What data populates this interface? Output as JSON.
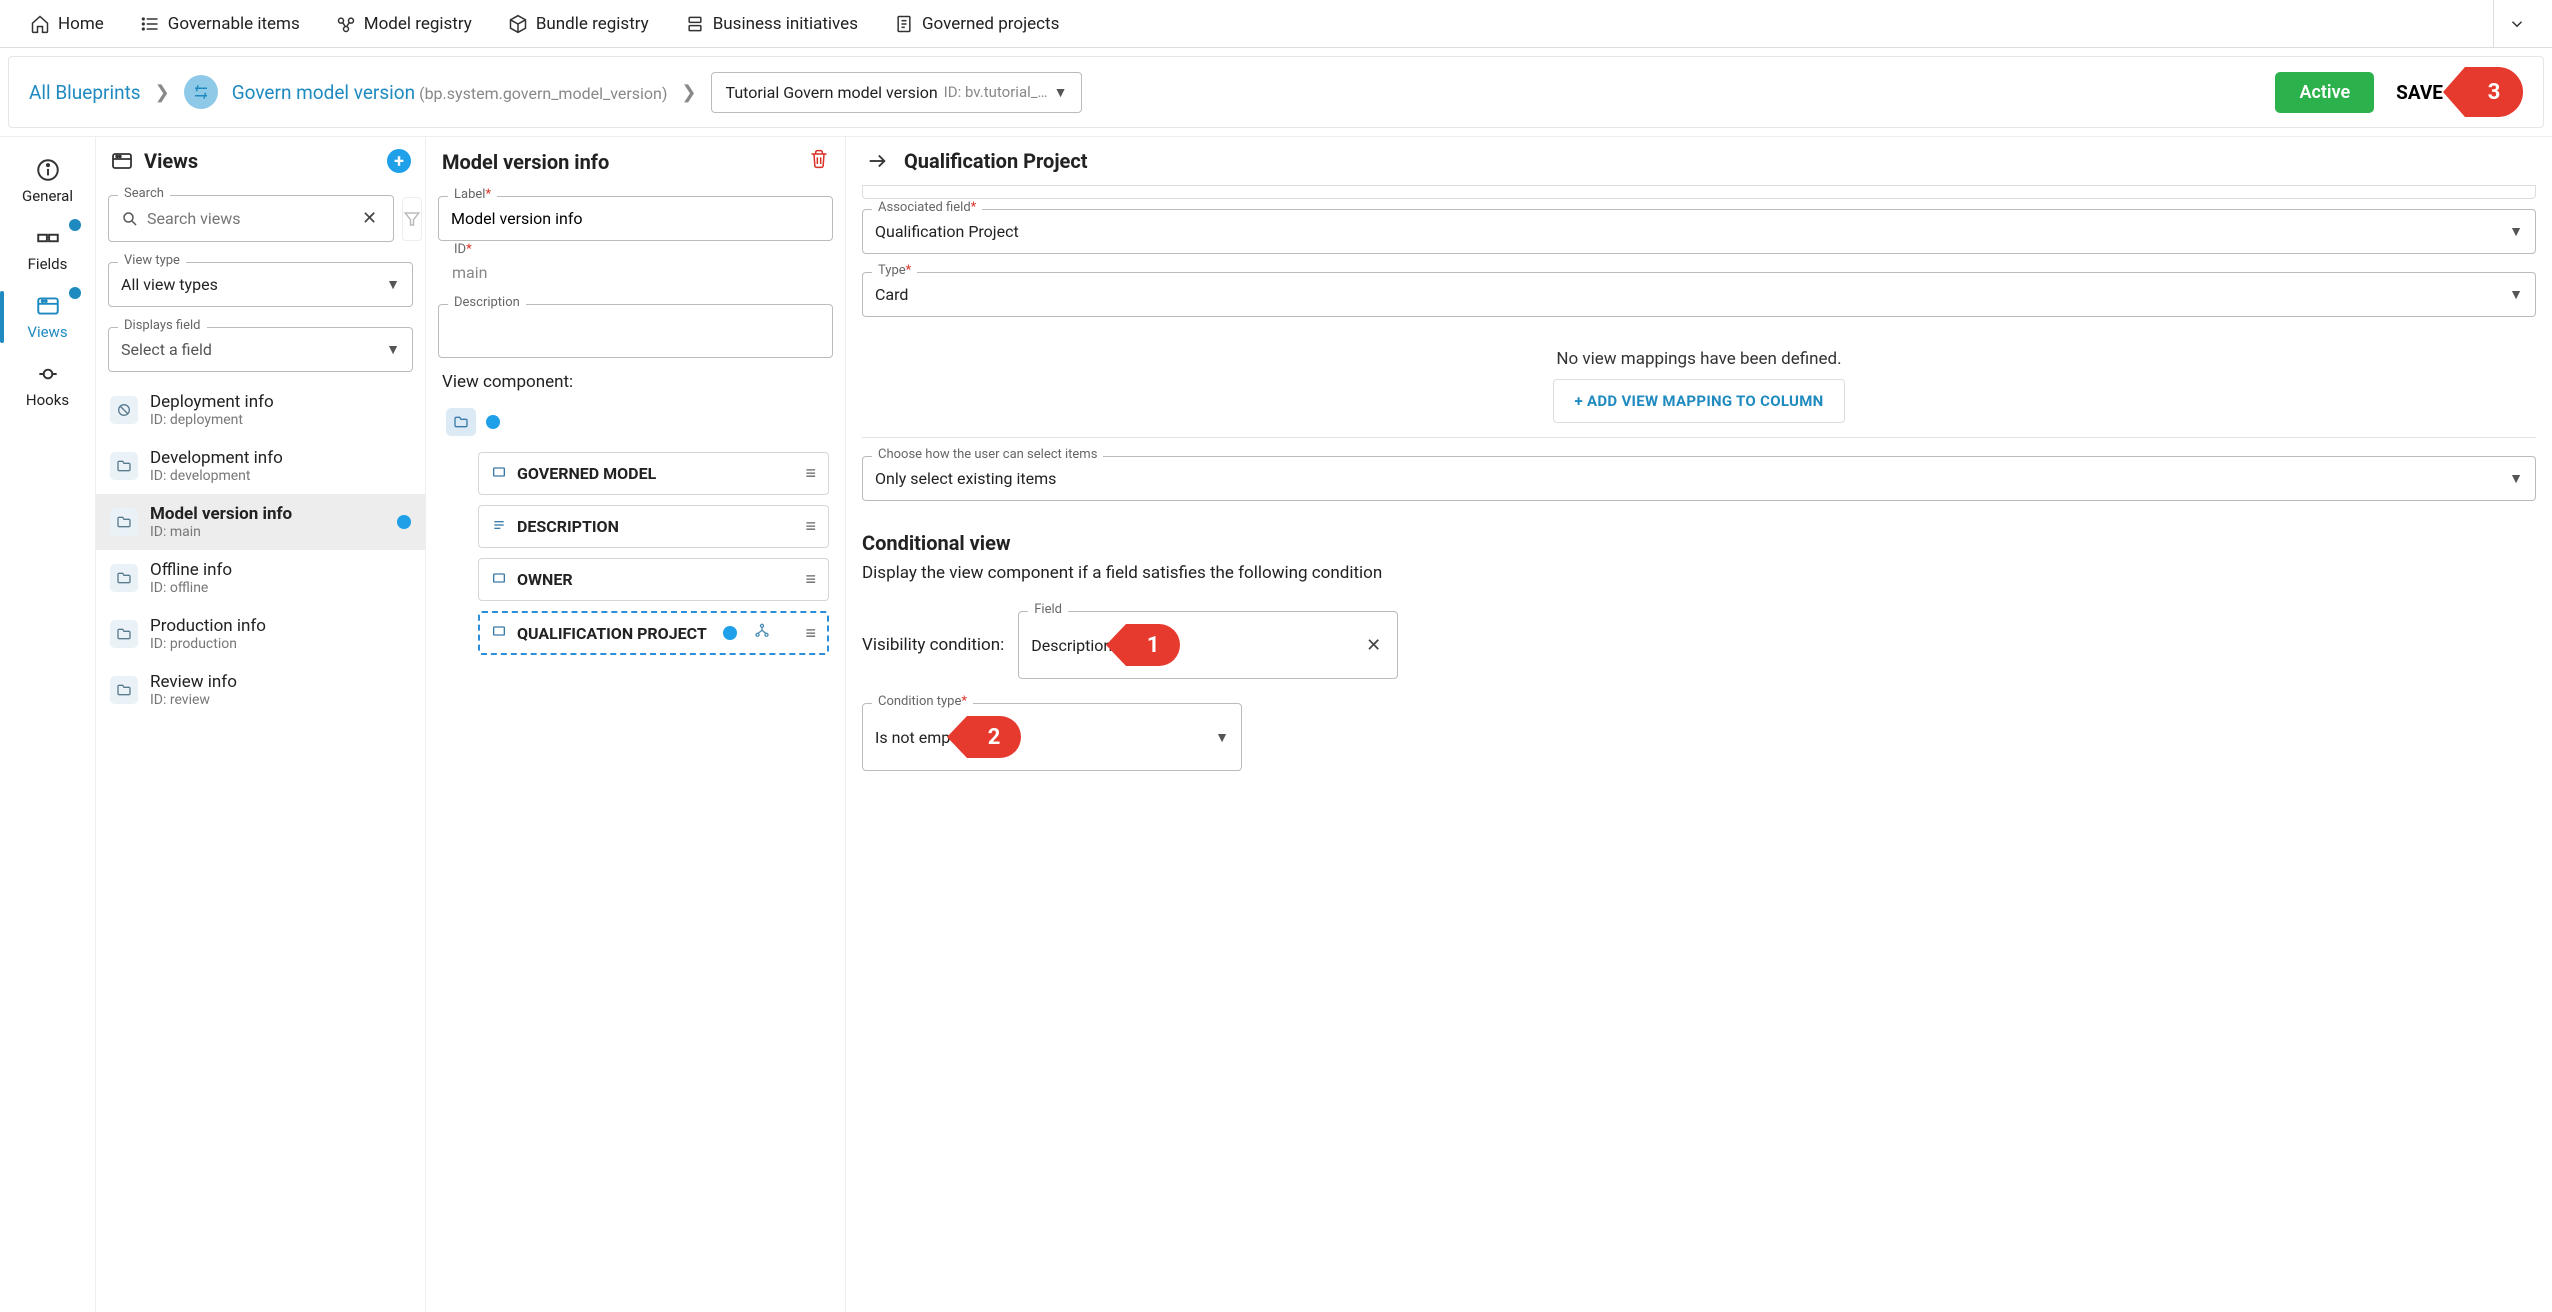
{
  "topnav": {
    "items": [
      {
        "label": "Home"
      },
      {
        "label": "Governable items"
      },
      {
        "label": "Model registry"
      },
      {
        "label": "Bundle registry"
      },
      {
        "label": "Business initiatives"
      },
      {
        "label": "Governed projects"
      }
    ]
  },
  "breadcrumb": {
    "root": "All Blueprints",
    "bp_name": "Govern model version",
    "bp_id": "(bp.system.govern_model_version)",
    "version_name": "Tutorial Govern model version",
    "version_id": "ID: bv.tutorial_…",
    "active_btn": "Active",
    "save_btn": "SAVE"
  },
  "callouts": {
    "c1": "1",
    "c2": "2",
    "c3": "3"
  },
  "lefttabs": {
    "general": "General",
    "fields": "Fields",
    "views": "Views",
    "hooks": "Hooks"
  },
  "views_panel": {
    "title": "Views",
    "search_legend": "Search",
    "search_placeholder": "Search views",
    "viewtype_legend": "View type",
    "viewtype_value": "All view types",
    "displays_legend": "Displays field",
    "displays_value": "Select a field",
    "items": [
      {
        "title": "Deployment info",
        "sub": "ID: deployment"
      },
      {
        "title": "Development info",
        "sub": "ID: development"
      },
      {
        "title": "Model version info",
        "sub": "ID: main"
      },
      {
        "title": "Offline info",
        "sub": "ID: offline"
      },
      {
        "title": "Production info",
        "sub": "ID: production"
      },
      {
        "title": "Review info",
        "sub": "ID: review"
      }
    ]
  },
  "center": {
    "title": "Model version info",
    "label_legend": "Label",
    "label_value": "Model version info",
    "id_legend": "ID",
    "id_value": "main",
    "desc_legend": "Description",
    "desc_value": "",
    "view_comp_label": "View component:",
    "components": [
      {
        "label": "GOVERNED MODEL",
        "icon": "card"
      },
      {
        "label": "DESCRIPTION",
        "icon": "text"
      },
      {
        "label": "OWNER",
        "icon": "card"
      },
      {
        "label": "QUALIFICATION PROJECT",
        "icon": "card"
      }
    ]
  },
  "right": {
    "title": "Qualification Project",
    "assoc_legend": "Associated field",
    "assoc_value": "Qualification Project",
    "type_legend": "Type",
    "type_value": "Card",
    "no_mappings": "No view mappings have been defined.",
    "add_mapping_btn": "+ ADD VIEW MAPPING TO COLUMN",
    "select_legend": "Choose how the user can select items",
    "select_value": "Only select existing items",
    "cond_title": "Conditional view",
    "cond_desc": "Display the view component if a field satisfies the following condition",
    "vis_label": "Visibility condition:",
    "field_legend": "Field",
    "field_value": "Description",
    "condtype_legend": "Condition type",
    "condtype_value": "Is not empty"
  }
}
